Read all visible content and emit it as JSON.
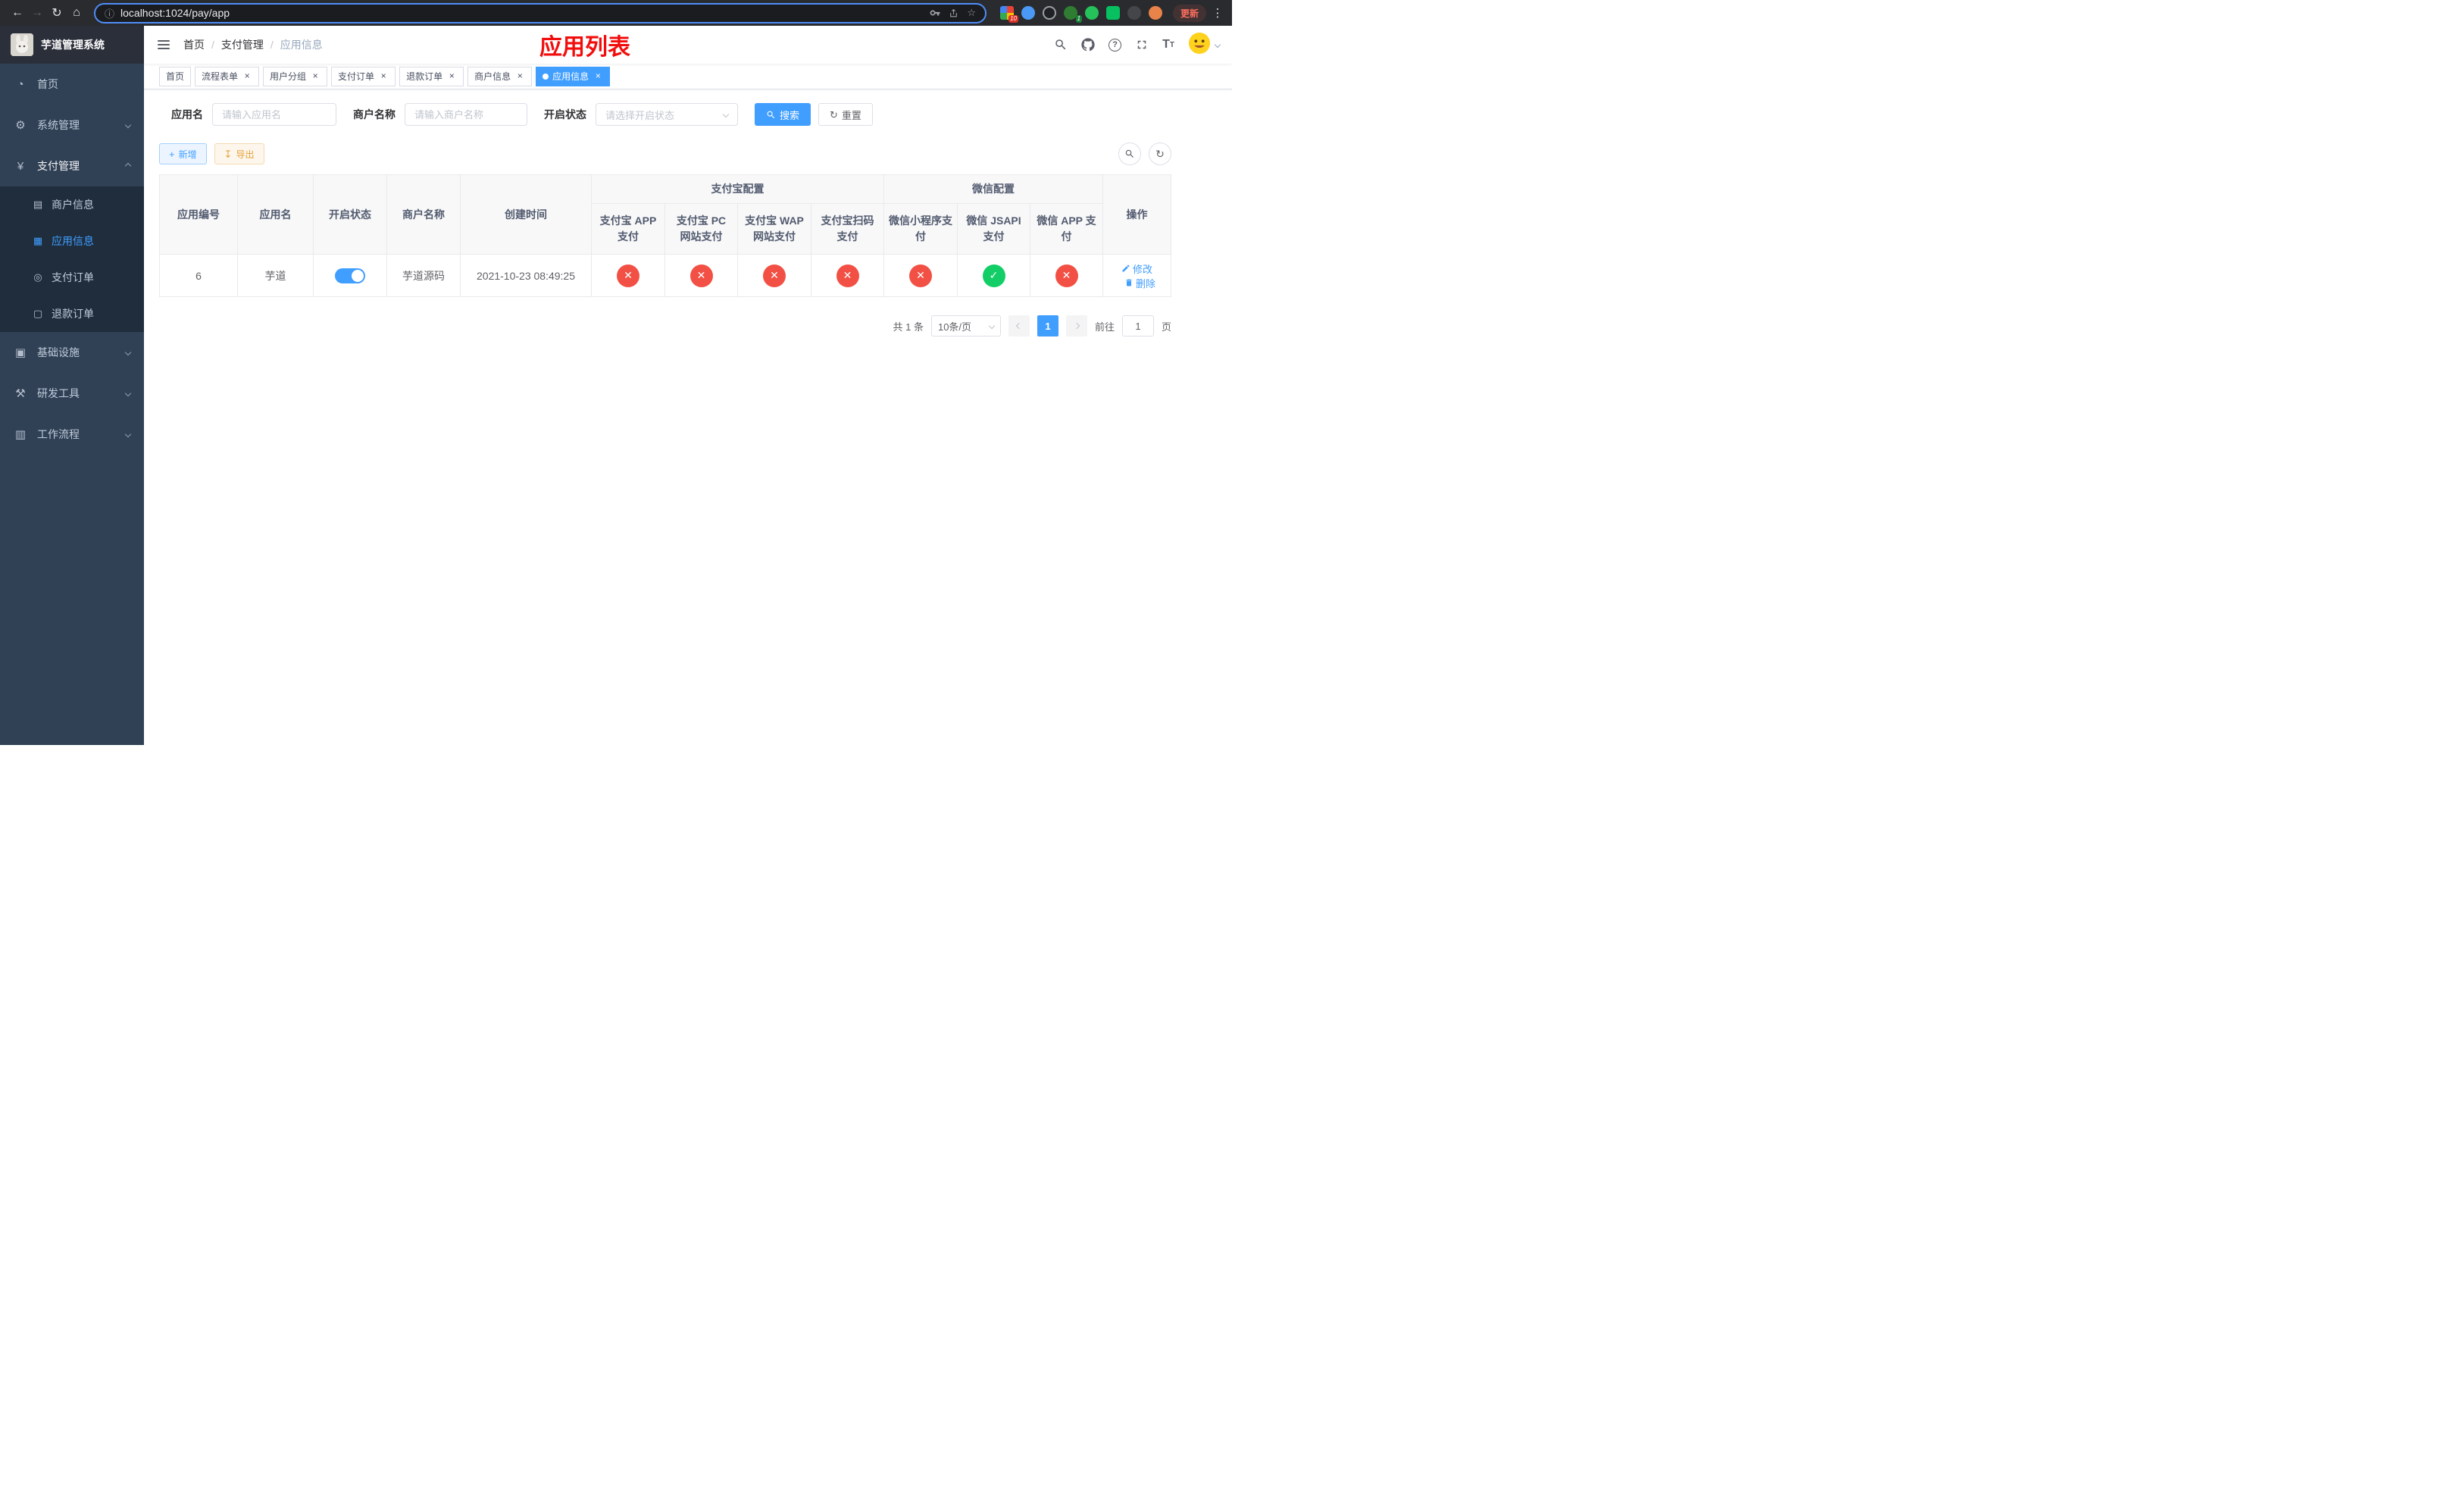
{
  "colors": {
    "accent": "#409eff",
    "danger": "#f25045",
    "success": "#13ce66",
    "warning": "#e6a23c",
    "title": "#f20d0d",
    "sidebar": "#304156",
    "submenu": "#1f2d3d"
  },
  "icons": {
    "back": "←",
    "forward": "→",
    "refresh": "↻",
    "home": "⌂",
    "info": "ⓘ",
    "star": "☆",
    "kebab": "⋮",
    "close": "×",
    "dashboard": "◔",
    "gear": "⚙",
    "yen": "¥",
    "card": "▤",
    "grid": "▦",
    "target": "◎",
    "doc": "▢",
    "monitor": "▣",
    "tools": "⚒",
    "box": "▥",
    "question": "?",
    "fontsize_large": "T",
    "fontsize_small": "T",
    "plus": "+",
    "download": "↧",
    "check": "✓",
    "cross": "✕"
  },
  "browser": {
    "url": "localhost:1024/pay/app",
    "update_label": "更新",
    "extension_badge_1": "10",
    "extension_badge_2": "1"
  },
  "sidebar": {
    "app_title": "芋道管理系统",
    "home": "首页",
    "system": "系统管理",
    "pay": "支付管理",
    "merchant": "商户信息",
    "app_info": "应用信息",
    "pay_order": "支付订单",
    "refund_order": "退款订单",
    "infra": "基础设施",
    "devtools": "研发工具",
    "workflow": "工作流程"
  },
  "navbar": {
    "breadcrumb": [
      "首页",
      "支付管理",
      "应用信息"
    ],
    "separator": "/",
    "page_title": "应用列表"
  },
  "tabs": [
    {
      "label": "首页"
    },
    {
      "label": "流程表单"
    },
    {
      "label": "用户分组"
    },
    {
      "label": "支付订单"
    },
    {
      "label": "退款订单"
    },
    {
      "label": "商户信息"
    },
    {
      "label": "应用信息"
    }
  ],
  "filters": {
    "app_name_label": "应用名",
    "app_name_placeholder": "请输入应用名",
    "merchant_name_label": "商户名称",
    "merchant_name_placeholder": "请输入商户名称",
    "status_label": "开启状态",
    "status_placeholder": "请选择开启状态",
    "search_label": "搜索",
    "reset_label": "重置"
  },
  "toolbar": {
    "add_label": "新增",
    "export_label": "导出"
  },
  "table": {
    "headers": {
      "app_id": "应用编号",
      "app_name": "应用名",
      "status": "开启状态",
      "merchant": "商户名称",
      "created": "创建时间",
      "alipay_group": "支付宝配置",
      "wechat_group": "微信配置",
      "alipay_app": "支付宝 APP 支付",
      "alipay_pc": "支付宝 PC 网站支付",
      "alipay_wap": "支付宝 WAP 网站支付",
      "alipay_qr": "支付宝扫码支付",
      "wx_lite": "微信小程序支付",
      "wx_jsapi": "微信 JSAPI 支付",
      "wx_app": "微信 APP 支付",
      "ops": "操作"
    },
    "row": {
      "app_id": "6",
      "app_name": "芋道",
      "status_on": true,
      "merchant": "芋道源码",
      "created": "2021-10-23 08:49:25",
      "configs": [
        false,
        false,
        false,
        false,
        false,
        true,
        false
      ],
      "edit_label": "修改",
      "delete_label": "删除"
    }
  },
  "pagination": {
    "total_text": "共 1 条",
    "page_size": "10条/页",
    "current_page": "1",
    "goto_label": "前往",
    "goto_value": "1",
    "unit_label": "页"
  }
}
